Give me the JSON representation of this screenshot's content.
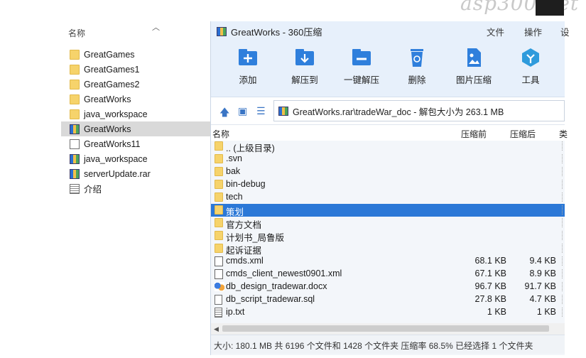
{
  "watermark": "asp300.net",
  "explorer": {
    "header": "名称",
    "items": [
      {
        "name": "GreatGames",
        "icon": "folder-icon"
      },
      {
        "name": "GreatGames1",
        "icon": "folder-icon"
      },
      {
        "name": "GreatGames2",
        "icon": "folder-icon"
      },
      {
        "name": "GreatWorks",
        "icon": "folder-icon"
      },
      {
        "name": "java_workspace",
        "icon": "folder-icon"
      },
      {
        "name": "GreatWorks",
        "icon": "archive-icon",
        "selected": true
      },
      {
        "name": "GreatWorks11",
        "icon": "file-icon"
      },
      {
        "name": "java_workspace",
        "icon": "archive-icon"
      },
      {
        "name": "serverUpdate.rar",
        "icon": "archive-icon"
      },
      {
        "name": "介绍",
        "icon": "text-file-icon"
      }
    ]
  },
  "window": {
    "title": "GreatWorks - 360压缩",
    "menu": [
      "文件",
      "操作",
      "设"
    ],
    "toolbar": [
      {
        "label": "添加",
        "icon": "add-archive-icon"
      },
      {
        "label": "解压到",
        "icon": "extract-to-icon"
      },
      {
        "label": "一键解压",
        "icon": "one-click-extract-icon"
      },
      {
        "label": "删除",
        "icon": "recycle-bin-icon"
      },
      {
        "label": "图片压缩",
        "icon": "image-compress-icon"
      },
      {
        "label": "工具",
        "icon": "tools-icon"
      }
    ],
    "address": "GreatWorks.rar\\tradeWar_doc - 解包大小为 263.1 MB",
    "columns": {
      "name": "名称",
      "compressed_before": "压缩前",
      "compressed_after": "压缩后",
      "extra": "类"
    },
    "files": [
      {
        "name": ".. (上级目录)",
        "icon": "folder-icon",
        "size": "",
        "packed": ""
      },
      {
        "name": ".svn",
        "icon": "folder-icon",
        "size": "",
        "packed": ""
      },
      {
        "name": "bak",
        "icon": "folder-icon",
        "size": "",
        "packed": ""
      },
      {
        "name": "bin-debug",
        "icon": "folder-icon",
        "size": "",
        "packed": ""
      },
      {
        "name": "tech",
        "icon": "folder-icon",
        "size": "",
        "packed": ""
      },
      {
        "name": "策划",
        "icon": "folder-icon",
        "size": "",
        "packed": "",
        "selected": true
      },
      {
        "name": "官方文档",
        "icon": "folder-icon",
        "size": "",
        "packed": ""
      },
      {
        "name": "计划书_局鲁版",
        "icon": "folder-icon",
        "size": "",
        "packed": ""
      },
      {
        "name": "起诉证据",
        "icon": "folder-icon",
        "size": "",
        "packed": ""
      },
      {
        "name": "cmds.xml",
        "icon": "xml-file-icon",
        "size": "68.1 KB",
        "packed": "9.4 KB"
      },
      {
        "name": "cmds_client_newest0901.xml",
        "icon": "xml-file-icon",
        "size": "67.1 KB",
        "packed": "8.9 KB"
      },
      {
        "name": "db_design_tradewar.docx",
        "icon": "docx-file-icon",
        "size": "96.7 KB",
        "packed": "91.7 KB"
      },
      {
        "name": "db_script_tradewar.sql",
        "icon": "file-icon",
        "size": "27.8 KB",
        "packed": "4.7 KB"
      },
      {
        "name": "ip.txt",
        "icon": "text-file-icon",
        "size": "1 KB",
        "packed": "1 KB"
      }
    ],
    "status": "大小: 180.1 MB 共 6196 个文件和 1428 个文件夹 压缩率 68.5% 已经选择 1 个文件夹"
  }
}
